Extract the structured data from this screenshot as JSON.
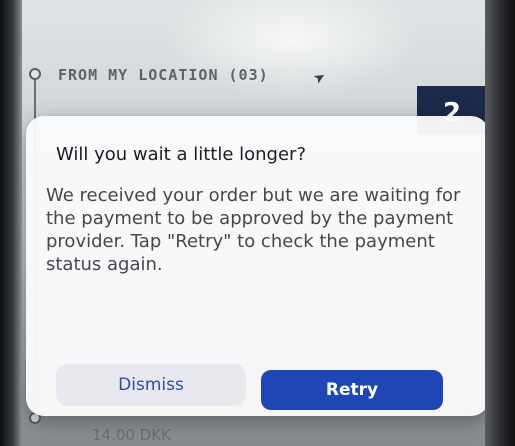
{
  "background": {
    "from_label": "FROM MY LOCATION (03)",
    "badge": "2",
    "price": "14.00 DKK"
  },
  "dialog": {
    "title": "Will you wait a little longer?",
    "message": "We received your order but we are waiting for the payment to be approved by the payment provider. Tap \"Retry\" to check the payment status again.",
    "dismiss_label": "Dismiss",
    "retry_label": "Retry"
  },
  "colors": {
    "retry_button": "#1f46b5",
    "dismiss_text": "#2f4f9a",
    "badge_bg": "#1c2b4a"
  },
  "icons": {
    "location": "location-arrow-icon"
  }
}
